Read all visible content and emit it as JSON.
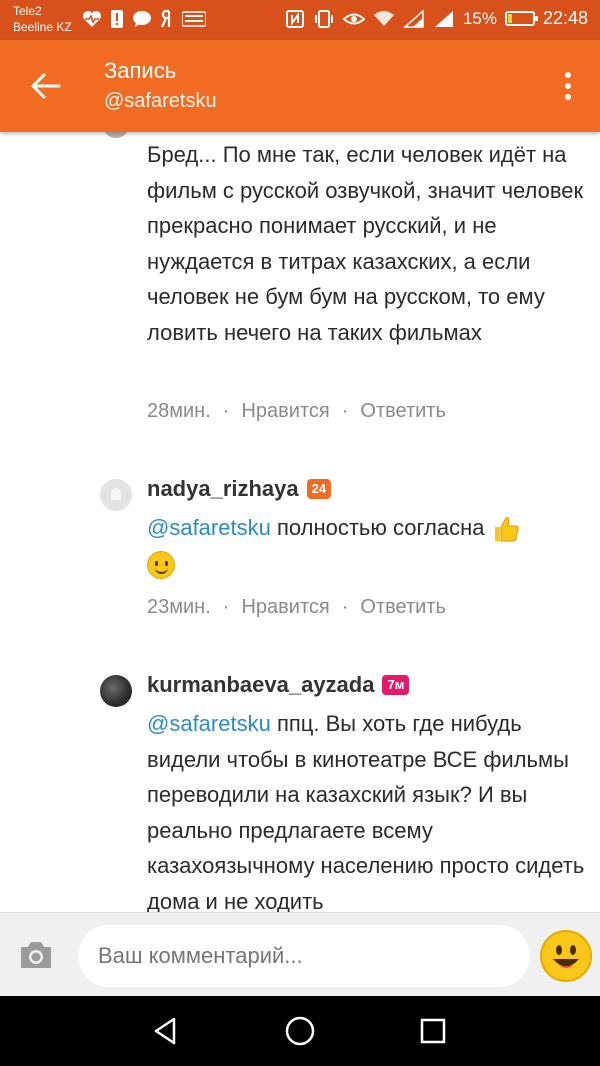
{
  "status_bar": {
    "carrier1": "Tele2",
    "carrier2": "Beeline KZ",
    "battery_percent": "15%",
    "battery_level": 0.15,
    "time": "22:48",
    "battery_color": "#ffd23c"
  },
  "app_bar": {
    "title": "Запись",
    "subtitle": "@safaretsku",
    "color": "#f26b22"
  },
  "comments": [
    {
      "text": "Бред... По мне так, если человек идёт на фильм с русской озвучкой, значит человек прекрасно понимает русский, и не нуждается в титрах казахских, а если человек не бум бум на русском, то ему ловить нечего на таких фильмах",
      "time": "28мин.",
      "like": "Нравится",
      "reply": "Ответить"
    },
    {
      "author": "nadya_rizhaya",
      "badge": "24",
      "badge_color": "#f26b22",
      "mention": "@safaretsku",
      "text": "полностью согласна",
      "time": "23мин.",
      "like": "Нравится",
      "reply": "Ответить"
    },
    {
      "author": "kurmanbaeva_ayzada",
      "badge": "7м",
      "badge_color": "#e5196a",
      "mention": "@safaretsku",
      "text": "ппц. Вы хоть где нибудь видели чтобы в кинотеатре ВСЕ фильмы переводили на казахский язык? И вы реально предлагаете всему казахоязычному населению просто сидеть дома и не ходить"
    }
  ],
  "separator": "·",
  "input": {
    "placeholder": "Ваш комментарий..."
  },
  "icons": {
    "back": "arrow-left-icon",
    "more": "more-vertical-icon",
    "camera": "camera-icon",
    "emoji": "smiley-icon",
    "nav_back": "triangle-back-icon",
    "nav_home": "circle-home-icon",
    "nav_recent": "square-recents-icon"
  }
}
